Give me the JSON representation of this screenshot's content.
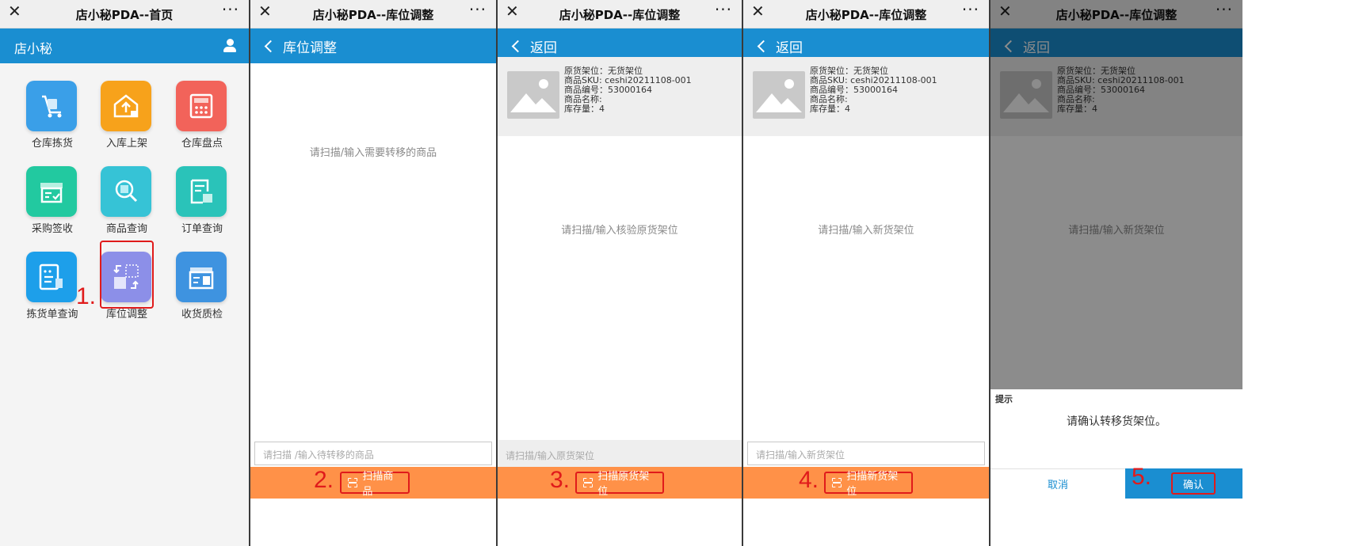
{
  "colors": {
    "primary": "#1a8ed1",
    "action": "#ff9148",
    "annotation": "#e01b1b"
  },
  "titlebar": {
    "close": "✕",
    "more": "···"
  },
  "screens": [
    {
      "title": "店小秘PDA--首页",
      "nav_title": "店小秘",
      "nav_icon": "user-icon",
      "tiles": [
        {
          "label": "仓库拣货",
          "icon": "trolley-icon",
          "color": "#3a9fe8"
        },
        {
          "label": "入库上架",
          "icon": "house-upload-icon",
          "color": "#f7a21b"
        },
        {
          "label": "仓库盘点",
          "icon": "calculator-icon",
          "color": "#f2635a"
        },
        {
          "label": "采购签收",
          "icon": "box-check-icon",
          "color": "#22c9a0"
        },
        {
          "label": "商品查询",
          "icon": "magnifier-icon",
          "color": "#36c3d6"
        },
        {
          "label": "订单查询",
          "icon": "document-check-icon",
          "color": "#2ac3b9"
        },
        {
          "label": "拣货单查询",
          "icon": "list-doc-icon",
          "color": "#1d9fea"
        },
        {
          "label": "库位调整",
          "icon": "swap-location-icon",
          "color": "#8c8fe8"
        },
        {
          "label": "收货质检",
          "icon": "inspection-card-icon",
          "color": "#3e93e0"
        }
      ],
      "step": "1."
    },
    {
      "title": "店小秘PDA--库位调整",
      "nav_back": "库位调整",
      "hint": "请扫描/输入需要转移的商品",
      "input_placeholder": "请扫描 /输入待转移的商品",
      "action": "扫描商品",
      "step": "2."
    },
    {
      "title": "店小秘PDA--库位调整",
      "nav_back": "返回",
      "hint": "请扫描/输入核验原货架位",
      "input_placeholder": "请扫描/输入原货架位",
      "action": "扫描原货架位",
      "step": "3."
    },
    {
      "title": "店小秘PDA--库位调整",
      "nav_back": "返回",
      "hint": "请扫描/输入新货架位",
      "input_placeholder": "请扫描/输入新货架位",
      "action": "扫描新货架位",
      "step": "4."
    },
    {
      "title": "店小秘PDA--库位调整",
      "nav_back": "返回",
      "hint": "请扫描/输入新货架位",
      "dialog": {
        "title": "提示",
        "message": "请确认转移货架位。",
        "cancel": "取消",
        "confirm": "确认"
      },
      "step": "5."
    }
  ],
  "product": {
    "lines": [
      "原货架位：无货架位",
      "商品SKU: ceshi20211108-001",
      "商品编号：53000164",
      "商品名称:",
      "库存量：4"
    ]
  }
}
